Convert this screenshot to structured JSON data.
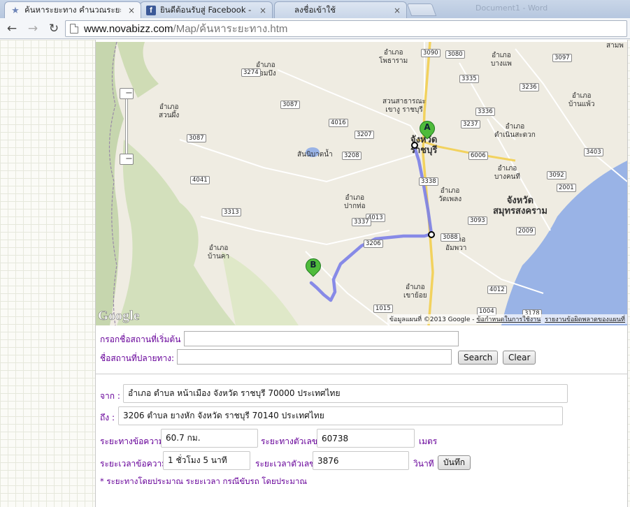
{
  "browser": {
    "tabs": [
      {
        "title": "ค้นหาระยะทาง คำนวณระยะทาง",
        "favicon": "star-icon",
        "active": true
      },
      {
        "title": "ยินดีต้อนรับสู่ Facebook - เข้",
        "favicon": "facebook-icon",
        "active": false
      },
      {
        "title": "ลงชื่อเข้าใช้",
        "favicon": "windows-icon",
        "active": false
      }
    ],
    "close_glyph": "×",
    "profile_text": "Document1 - Word",
    "url_host": "www.novabizz.com",
    "url_path": "/Map/ค้นหาระยะทาง.htm"
  },
  "map": {
    "place_labels": [
      {
        "text": "อำเภอ\nโพธาราม"
      },
      {
        "text": "อำเภอ\nจอมบึง"
      },
      {
        "text": "อำเภอ\nบางแพ"
      },
      {
        "text": "สวนสาธารณะ\nเขางู ราชบุรี"
      },
      {
        "text": "อำเภอ\nบ้านแพ้ว"
      },
      {
        "text": "อำเภอ\nสวนผึ้ง"
      },
      {
        "text": "อำเภอ\nดำเนินสะดวก"
      },
      {
        "text": "สันนิบาตน้ำ"
      },
      {
        "text": "อำเภอ\nบางคนที"
      },
      {
        "text": "อำเภอ\nวัดเพลง"
      },
      {
        "text": "อำเภอ\nปากท่อ"
      },
      {
        "text": "อำเภอ\nบ้านคา"
      },
      {
        "text": "อำเภอ\nอัมพวา"
      },
      {
        "text": "อำเภอ\nเขาย้อย"
      },
      {
        "text": "สามพ"
      }
    ],
    "big_labels": [
      {
        "text": "จังหวัด\nราชบุรี"
      },
      {
        "text": "จังหวัด\nสมุทรสงคราม"
      }
    ],
    "road_shields": [
      "3090",
      "3080",
      "3274",
      "3097",
      "3335",
      "3236",
      "3087",
      "3336",
      "3237",
      "4016",
      "3207",
      "3087",
      "3208",
      "6006",
      "3403",
      "4041",
      "3338",
      "3092",
      "2001",
      "3313",
      "4013",
      "3093",
      "3337",
      "2009",
      "3206",
      "3088",
      "1015",
      "4012",
      "1004",
      "3178"
    ],
    "marker_a": "A",
    "marker_b": "B",
    "zoom_in": "−",
    "zoom_out": "−",
    "logo": "Google",
    "attribution": "ข้อมูลแผนที่ ©2013 Google - ",
    "terms_link": "ข้อกำหนดในการใช้งาน",
    "report_link": "รายงานข้อผิดพลาดของแผนที่"
  },
  "search": {
    "start_label": "กรอกชื่อสถานที่เริ่มต้น :",
    "end_label": "ชื่อสถานที่ปลายทาง:",
    "start_value": "",
    "end_value": "",
    "search_button": "Search",
    "clear_button": "Clear"
  },
  "result": {
    "from_label": "จาก :",
    "from_value": "อำเภอ ตำบล หน้าเมือง จังหวัด ราชบุรี 70000 ประเทศไทย",
    "to_label": "ถึง :",
    "to_value": "3206 ตำบล ยางหัก จังหวัด ราชบุรี 70140 ประเทศไทย",
    "distance_text_label": "ระยะทางข้อความ",
    "distance_text_value": "60.7 กม.",
    "distance_num_label": "ระยะทางตัวเลข",
    "distance_num_value": "60738",
    "distance_unit": "เมตร",
    "time_text_label": "ระยะเวลาข้อความ",
    "time_text_value": "1 ชั่วโมง 5 นาที",
    "time_num_label": "ระยะเวลาตัวเลข",
    "time_num_value": "3876",
    "time_unit": "วินาที",
    "save_button": "บันทึก",
    "note": "* ระยะทางโดยประมาณ ระยะเวลา กรณีขับรถ โดยประมาณ"
  },
  "colors": {
    "route": "#7b7fe8",
    "label_purple": "#660099",
    "sea": "#99b3e6",
    "forest": "#c8d8b0"
  }
}
